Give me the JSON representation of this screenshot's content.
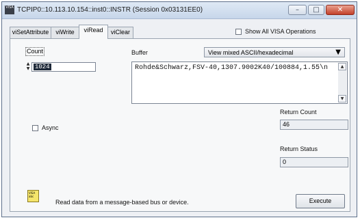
{
  "window": {
    "title": "TCPIP0::10.113.10.154::inst0::INSTR (Session 0x03131EE0)",
    "app_icon_text": "VISA",
    "controls": {
      "minimize": "minimize-icon",
      "maximize": "maximize-icon",
      "close": "close-icon"
    }
  },
  "tabs": [
    {
      "label": "viSetAttribute",
      "active": false
    },
    {
      "label": "viWrite",
      "active": false
    },
    {
      "label": "viRead",
      "active": true
    },
    {
      "label": "viClear",
      "active": false
    }
  ],
  "show_all_ops": {
    "label": "Show All VISA Operations",
    "checked": false
  },
  "count": {
    "label": "Count",
    "value": "1024"
  },
  "buffer": {
    "label": "Buffer",
    "view_mode": "View mixed ASCII/hexadecimal",
    "content": "Rohde&Schwarz,FSV-40,1307.9002K40/100884,1.55\\n"
  },
  "async": {
    "label": "Async",
    "checked": false
  },
  "return_count": {
    "label": "Return Count",
    "value": "46"
  },
  "return_status": {
    "label": "Return Status",
    "value": "0"
  },
  "status_text": "Read data from a message-based bus or device.",
  "status_icon_text": "VISA abc",
  "execute_label": "Execute"
}
